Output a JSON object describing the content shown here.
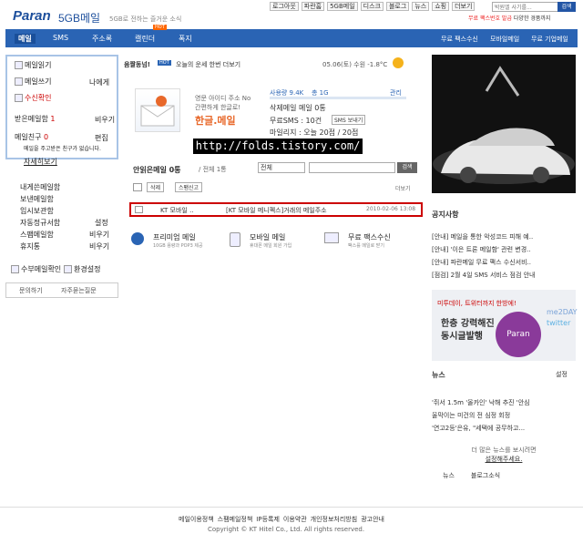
{
  "header": {
    "logo": "Paran",
    "logo_sub": "5GB메일",
    "slogan": "5GB로 전하는 즐거운 소식",
    "top_links": [
      "로그아웃",
      "파란홈",
      "5GB메일",
      "디스크",
      "블로그",
      "뉴스",
      "쇼핑",
      "더보기"
    ],
    "search_placeholder": "박원엘 사기를...",
    "search_btn": "검색",
    "promo_a": "무료 팩스번호 발급",
    "promo_b": "다양한 경품까지"
  },
  "nav": {
    "items": [
      "메일",
      "SMS",
      "주소록",
      "캘린더",
      "폭지"
    ],
    "hot": "HOT",
    "right": [
      "무료 팩스수신",
      "모바일메일",
      "무료 기업메일"
    ]
  },
  "left": {
    "read": "메일읽기",
    "write": "메일쓰기",
    "write_side": "나에게",
    "receive": "수신확인",
    "spam": "받은메일함",
    "spam_count": "1",
    "spam_side": "비우기",
    "friend": "메일친구",
    "friend_count": "0",
    "friend_side": "편집",
    "friend_desc": "메일을 주고받은 친구가 없습니다.",
    "friend_link": "자세히보기",
    "boxes": [
      "내게쓴메일함",
      "보낸메일함",
      "임시보관함",
      "자동정규서함",
      "스팸메일함",
      "휴지통"
    ],
    "box_sides": [
      "",
      "",
      "",
      "설정",
      "비우기",
      "비우기"
    ],
    "bottom_a": "수부메일확인",
    "bottom_b": "환경설정",
    "btn_a": "문의하기",
    "btn_b": "자주묻는질문"
  },
  "main": {
    "top_label": "움짤동넘!",
    "top_hot": "HOT",
    "top_text": "오늘의 운세 한번 더보기",
    "date": "05.06(토) 수원 -1.8°C",
    "welcome_a": "영문 아이디 주소 No",
    "welcome_b": "간편하게 한글로!",
    "welcome_c": "한글.메일",
    "usage_label": "사용량 9.4K",
    "usage_total": "총 1G",
    "usage_side": "관리",
    "write_label": "삭제메일 메일 0통",
    "sms_label": "무료SMS : 10건",
    "sms_btn": "SMS 보내기",
    "mileage": "마일리지 : 오늘 20점 / 20점",
    "url": "http://folds.tistory.com/",
    "inbox_title": "안읽은메일 0통",
    "inbox_total": "/ 전체 1통",
    "inbox_filter": "전체",
    "inbox_btn": "검색",
    "del": "삭제",
    "spam_report": "스팸신고",
    "more": "더보기",
    "mail_sender": "KT 모바일 ..",
    "mail_subject": "[KT 모바일 메니펙스]거래의 메일주소",
    "mail_date": "2010-02-06 13:08",
    "svc": [
      {
        "t": "프리미엄 메일",
        "s": "10GB 용량과 POP3 제공"
      },
      {
        "t": "모바일 메일",
        "s": "휴대폰 메일 회원 가입"
      },
      {
        "t": "무료 팩스수신",
        "s": "팩스를 메일로 받기"
      }
    ]
  },
  "right": {
    "notice_title": "공지사항",
    "notice_items": [
      "[안내] 메일을 통한 악성코드 피해 예..",
      "[안내] '이은 트론 메일함' 관련 변경..",
      "[안내] 파란메일 무료 팩스 수신서비..",
      "[점검] 2월 4일 SMS 서비스 점검 안내"
    ],
    "ad2_a": "미투데이, 트위터까지 한방에!",
    "ad2_b": "한층 강력해진",
    "ad2_c": "동시글발행",
    "ad2_badge": "me2DAY",
    "ad2_tw": "twitter",
    "ad2_circle": "Paran",
    "news_title": "뉴스",
    "news_side": "설정",
    "news_items": [
      "'쥐서 1.5m '올카인' 낙해 추진 '안심",
      "울막이는 미건의 전 심정 회정",
      "'연고2등'은유, \"세택에 공무하고..."
    ],
    "news_notice": "더 많은 뉴스를 보시려면",
    "news_link": "설정해주세요.",
    "tab_a": "뉴스",
    "tab_b": "블로그소식"
  },
  "footer": {
    "links": [
      "메일이용정책",
      "스팸메일정책",
      "IP등록제",
      "이용약관",
      "개인정보처리방침",
      "광고안내"
    ],
    "copy": "Copyright © KT Hitel Co., Ltd. All rights reserved."
  }
}
